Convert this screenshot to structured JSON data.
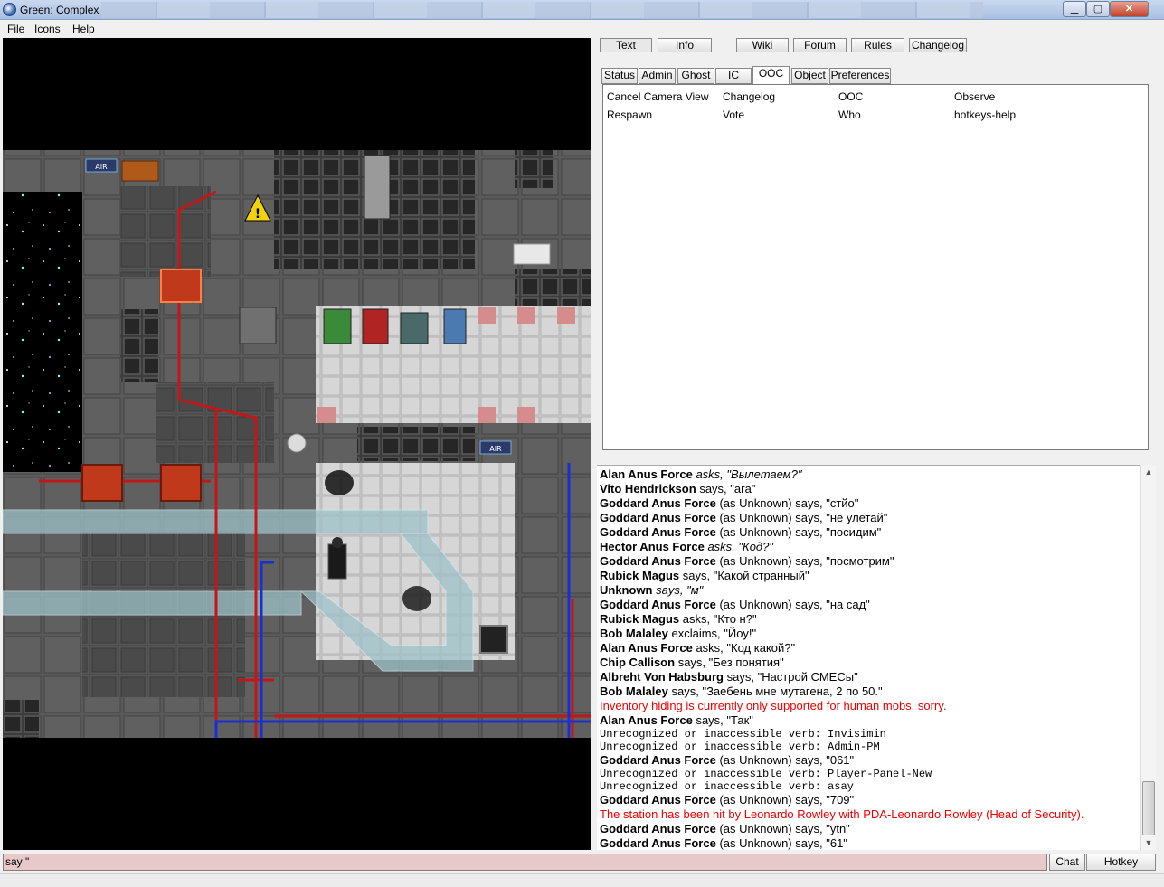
{
  "window": {
    "title": "Green: Complex",
    "min_glyph": "▁",
    "max_glyph": "▢",
    "close_glyph": "✕"
  },
  "menu": {
    "items": [
      "File",
      "Icons",
      "Help"
    ]
  },
  "top_buttons": {
    "text": "Text",
    "info": "Info",
    "wiki": "Wiki",
    "forum": "Forum",
    "rules": "Rules",
    "changelog": "Changelog"
  },
  "info_tabs": [
    "Status",
    "Admin",
    "Ghost",
    "IC",
    "OOC",
    "Object",
    "Preferences"
  ],
  "active_tab": "OOC",
  "verbs": [
    "Cancel Camera View",
    "Changelog",
    "OOC",
    "Observe",
    "Respawn",
    "Vote",
    "Who",
    "hotkeys-help"
  ],
  "chat_log": [
    {
      "speaker": "Alan Anus Force",
      "verb": "asks,",
      "text": "\"Вылетаем?\"",
      "italic": true
    },
    {
      "speaker": "Vito Hendrickson",
      "verb": "says,",
      "text": "\"ага\""
    },
    {
      "speaker": "Goddard Anus Force",
      "verb": "(as Unknown) says,",
      "text": "\"стйо\""
    },
    {
      "speaker": "Goddard Anus Force",
      "verb": "(as Unknown) says,",
      "text": "\"не улетай\""
    },
    {
      "speaker": "Goddard Anus Force",
      "verb": "(as Unknown) says,",
      "text": "\"посидим\""
    },
    {
      "speaker": "Hector Anus Force",
      "verb": "asks,",
      "text": "\"Код?\"",
      "italic": true
    },
    {
      "speaker": "Goddard Anus Force",
      "verb": "(as Unknown) says,",
      "text": "\"посмотрим\""
    },
    {
      "speaker": "Rubick Magus",
      "verb": "says,",
      "text": "\"Какой странный\""
    },
    {
      "speaker": "Unknown",
      "verb": "says,",
      "text": "\"м\"",
      "italic": true
    },
    {
      "speaker": "Goddard Anus Force",
      "verb": "(as Unknown) says,",
      "text": "\"на сад\""
    },
    {
      "speaker": "Rubick Magus",
      "verb": "asks,",
      "text": "\"Кто н?\""
    },
    {
      "speaker": "Bob Malaley",
      "verb": "exclaims,",
      "text": "\"Йоу!\""
    },
    {
      "speaker": "Alan Anus Force",
      "verb": "asks,",
      "text": "\"Код какой?\""
    },
    {
      "speaker": "Chip Callison",
      "verb": "says,",
      "text": "\"Без понятия\""
    },
    {
      "speaker": "Albreht Von Habsburg",
      "verb": "says,",
      "text": "\"Настрой СМЕСы\""
    },
    {
      "speaker": "Bob Malaley",
      "verb": "says,",
      "text": "\"Заебень мне мутагена, 2 по 50.\""
    },
    {
      "system": "Inventory hiding is currently only supported for human mobs, sorry.",
      "style": "red"
    },
    {
      "speaker": "Alan Anus Force",
      "verb": "says,",
      "text": "\"Так\""
    },
    {
      "system": "Unrecognized or inaccessible verb: Invisimin",
      "style": "mono"
    },
    {
      "system": "Unrecognized or inaccessible verb: Admin-PM",
      "style": "mono"
    },
    {
      "speaker": "Goddard Anus Force",
      "verb": "(as Unknown) says,",
      "text": "\"061\""
    },
    {
      "system": "Unrecognized or inaccessible verb: Player-Panel-New",
      "style": "mono"
    },
    {
      "system": "Unrecognized or inaccessible verb: asay",
      "style": "mono"
    },
    {
      "speaker": "Goddard Anus Force",
      "verb": "(as Unknown) says,",
      "text": "\"709\""
    },
    {
      "system": "The station has been hit by Leonardo Rowley with PDA-Leonardo Rowley (Head of Security).",
      "style": "red"
    },
    {
      "speaker": "Goddard Anus Force",
      "verb": "(as Unknown) says,",
      "text": "\"ytn\""
    },
    {
      "speaker": "Goddard Anus Force",
      "verb": "(as Unknown) says,",
      "text": "\"61\""
    }
  ],
  "input": {
    "value": "say \"",
    "chat_label": "Chat",
    "hotkey_label": "Hotkey Toggle"
  },
  "map": {
    "sign_labels": [
      "AIR",
      "AIR"
    ],
    "colors": {
      "floor": "#4a4a4a",
      "wall": "#2e2e2e",
      "pipe_red": "#c01818",
      "pipe_blue": "#1a2fd0",
      "glass": "#a6c9cf"
    }
  }
}
